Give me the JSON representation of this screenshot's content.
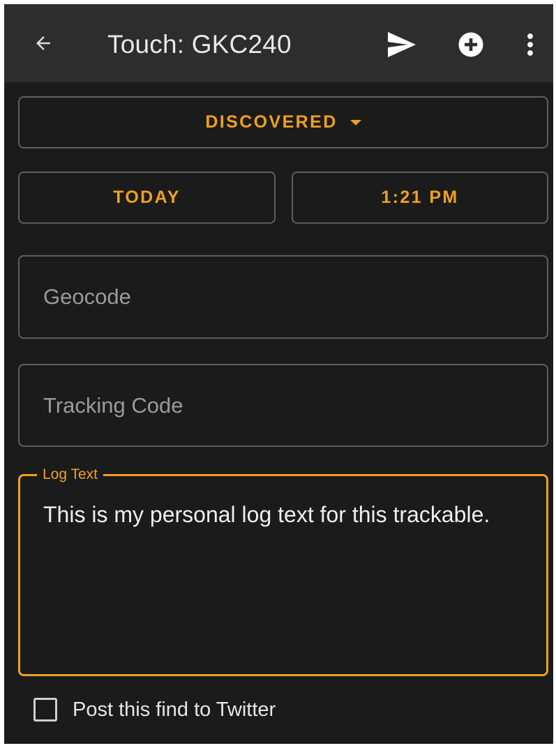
{
  "toolbar": {
    "title": "Touch: GKC240",
    "back_icon": "arrow-back-icon",
    "send_icon": "send-icon",
    "add_icon": "add-circle-icon",
    "more_icon": "more-vert-icon"
  },
  "log_type": {
    "selected": "DISCOVERED",
    "icon": "caret-down-icon"
  },
  "date_time": {
    "date_label": "TODAY",
    "time_label": "1:21 PM"
  },
  "fields": {
    "geocode_placeholder": "Geocode",
    "tracking_placeholder": "Tracking Code"
  },
  "log_text": {
    "label": "Log Text",
    "value": "This is my personal log text for this trackable."
  },
  "twitter": {
    "label": "Post this find to Twitter",
    "checked": false
  },
  "colors": {
    "accent": "#f0a020",
    "background": "#1b1b1b",
    "toolbar": "#2d2d2d",
    "outline": "#5e5e5e"
  }
}
